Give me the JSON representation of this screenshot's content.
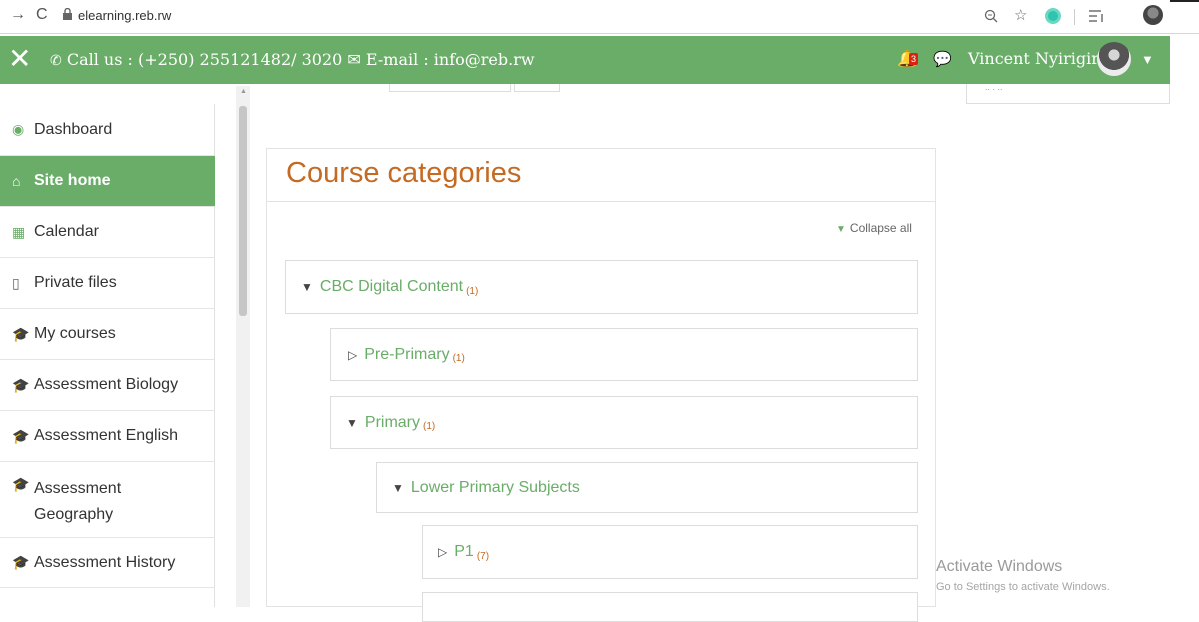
{
  "browser": {
    "back_icon": "→",
    "reload_icon": "C",
    "url": "elearning.reb.rw"
  },
  "header": {
    "contact": "Call us : (+250) 255121482/ 3020 ✉ E-mail : info@reb.rw",
    "notification_count": "3",
    "user_name": "Vincent Nyirigira",
    "accent": "#6aad68"
  },
  "sidebar": {
    "items": [
      {
        "label": "Dashboard",
        "icon": "dashboard-icon"
      },
      {
        "label": "Site home",
        "icon": "home-icon"
      },
      {
        "label": "Calendar",
        "icon": "calendar-icon"
      },
      {
        "label": "Private files",
        "icon": "file-icon"
      },
      {
        "label": "My courses",
        "icon": "graduation-cap-icon"
      },
      {
        "label": "Assessment Biology",
        "icon": "graduation-cap-icon"
      },
      {
        "label": "Assessment English",
        "icon": "graduation-cap-icon"
      },
      {
        "label": "Assessment",
        "label2": "Geography",
        "icon": "graduation-cap-icon"
      },
      {
        "label": "Assessment History",
        "icon": "graduation-cap-icon"
      }
    ]
  },
  "main": {
    "title": "Course categories",
    "collapse_label": "Collapse all",
    "categories": [
      {
        "label": "CBC Digital Content",
        "count": "(1)"
      },
      {
        "label": "Pre-Primary",
        "count": "(1)"
      },
      {
        "label": "Primary",
        "count": "(1)"
      },
      {
        "label": "Lower Primary Subjects",
        "count": ""
      },
      {
        "label": "P1",
        "count": "(7)"
      }
    ]
  },
  "watermark": {
    "line1": "Activate Windows",
    "line2": "Go to Settings to activate Windows."
  }
}
